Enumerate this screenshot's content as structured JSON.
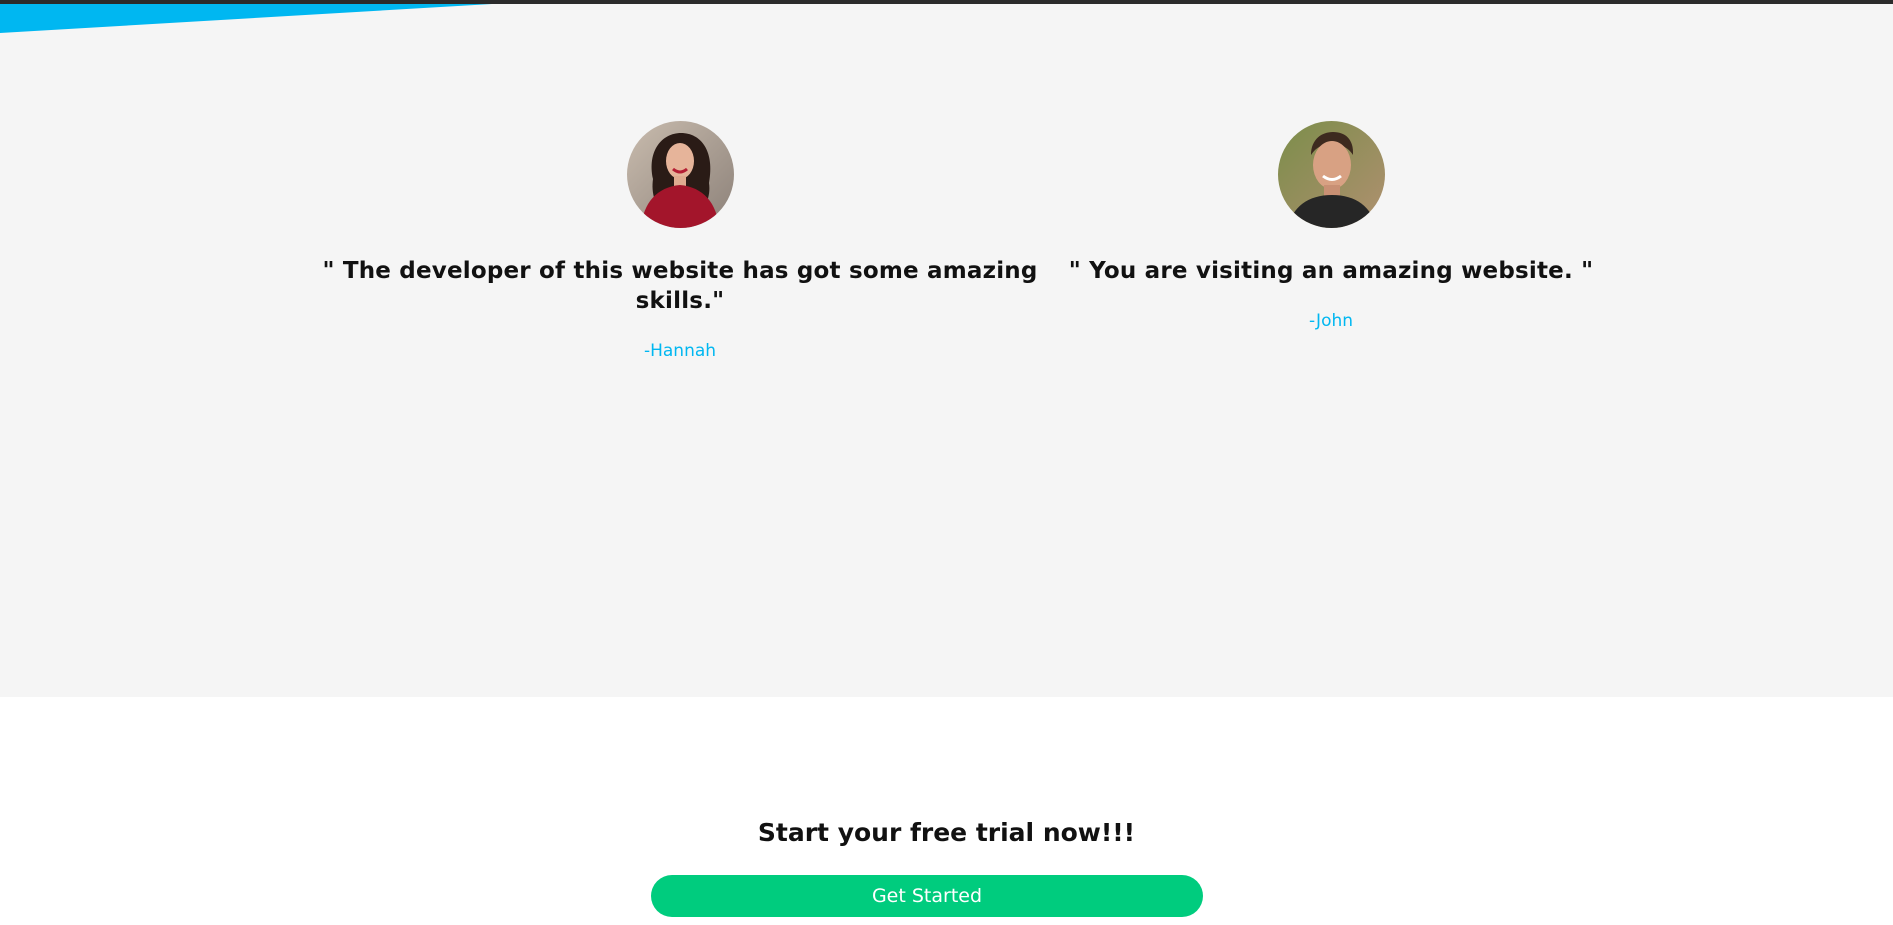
{
  "colors": {
    "accent": "#00b7f1",
    "testimonial_background": "#f5f5f5",
    "cta_button": "#00cc7e",
    "text": "#111111"
  },
  "testimonials": [
    {
      "avatar_icon": "user-photo-hannah",
      "quote": "\" The developer of this website has got some amazing skills.\"",
      "author": "-Hannah"
    },
    {
      "avatar_icon": "user-photo-john",
      "quote": "\" You are visiting an amazing website. \"",
      "author": "-John"
    }
  ],
  "cta": {
    "title": "Start your free trial now!!!",
    "button_label": "Get Started"
  }
}
